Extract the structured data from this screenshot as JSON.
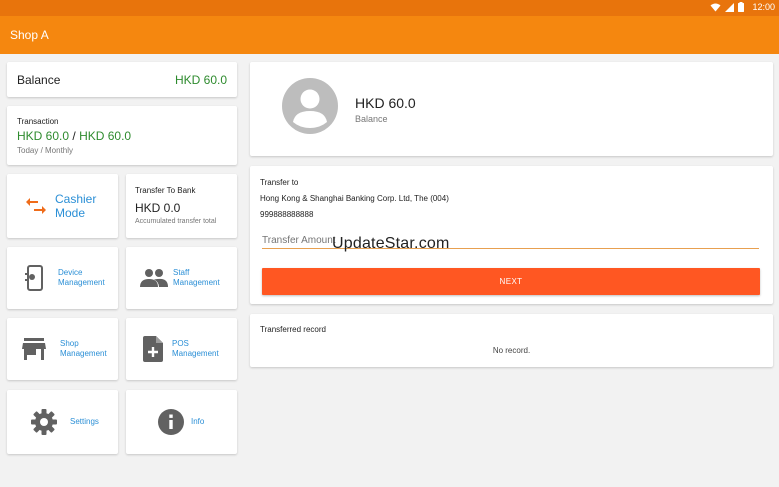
{
  "status_bar": {
    "time": "12:00",
    "icons": [
      "wifi-icon",
      "signal-icon",
      "battery-icon"
    ]
  },
  "app_bar": {
    "title": "Shop A"
  },
  "balance_card": {
    "label": "Balance",
    "amount": "HKD 60.0"
  },
  "transaction_card": {
    "label": "Transaction",
    "today": "HKD 60.0",
    "separator": "/",
    "monthly": "HKD 60.0",
    "caption": "Today / Monthly"
  },
  "cashier_tile": {
    "label_line1": "Cashier",
    "label_line2": "Mode",
    "icon": "swap-arrows-icon"
  },
  "transfer_bank_tile": {
    "label": "Transfer To Bank",
    "amount": "HKD 0.0",
    "caption": "Accumulated transfer total"
  },
  "tiles": {
    "device": {
      "line1": "Device",
      "line2": "Management",
      "icon": "device-phone-icon"
    },
    "staff": {
      "line1": "Staff",
      "line2": "Management",
      "icon": "people-icon"
    },
    "shop": {
      "line1": "Shop",
      "line2": "Management",
      "icon": "store-icon"
    },
    "pos": {
      "line1": "POS",
      "line2": "Management",
      "icon": "add-document-icon"
    },
    "settings": {
      "label": "Settings",
      "icon": "gear-icon"
    },
    "info": {
      "label": "Info",
      "icon": "info-icon"
    }
  },
  "profile_card": {
    "amount": "HKD 60.0",
    "caption": "Balance",
    "icon": "avatar-icon"
  },
  "transfer_card": {
    "label": "Transfer to",
    "bank": "Hong Kong & Shanghai Banking Corp. Ltd, The (004)",
    "account": "999888888888",
    "input_placeholder": "Transfer Amount",
    "next_label": "NEXT"
  },
  "record_card": {
    "title": "Transferred record",
    "empty_text": "No record."
  },
  "watermark": {
    "text": "UpdateStar.com"
  },
  "colors": {
    "status_bar": "#e8740c",
    "app_bar": "#f5870f",
    "amount_green": "#2e8b2e",
    "link_blue": "#2b8fd6",
    "next_button": "#ff5722",
    "cashier_icon": "#ef6c1a",
    "icon_gray": "#616161"
  }
}
